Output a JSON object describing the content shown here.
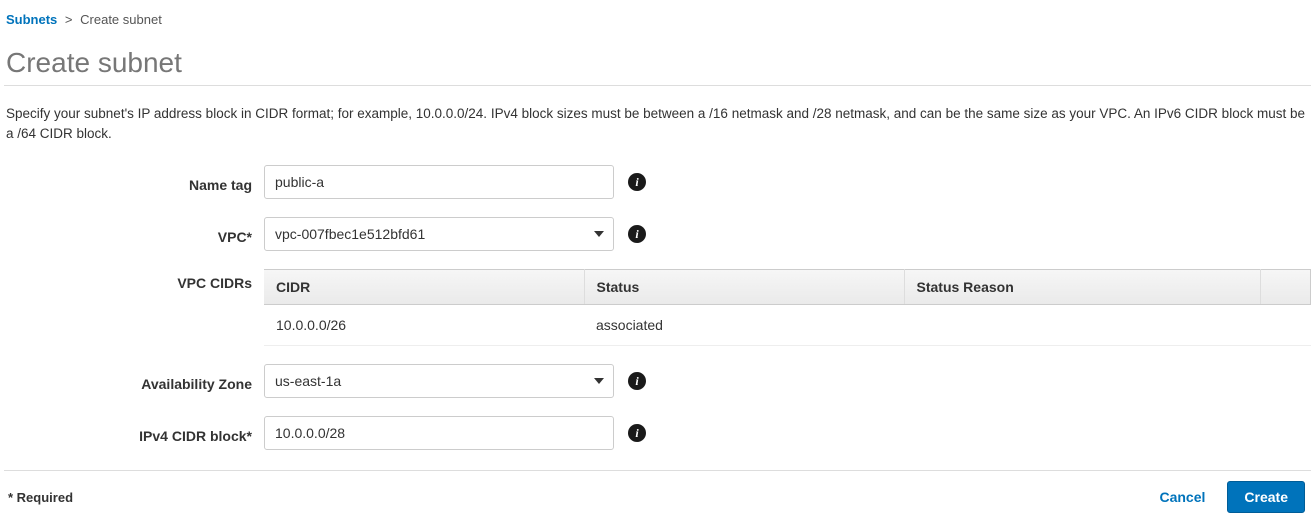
{
  "breadcrumb": {
    "parent": "Subnets",
    "separator": ">",
    "current": "Create subnet"
  },
  "page_title": "Create subnet",
  "description": "Specify your subnet's IP address block in CIDR format; for example, 10.0.0.0/24. IPv4 block sizes must be between a /16 netmask and /28 netmask, and can be the same size as your VPC. An IPv6 CIDR block must be a /64 CIDR block.",
  "form": {
    "name_tag": {
      "label": "Name tag",
      "value": "public-a"
    },
    "vpc": {
      "label": "VPC*",
      "value": "vpc-007fbec1e512bfd61"
    },
    "vpc_cidrs": {
      "label": "VPC CIDRs",
      "columns": {
        "cidr": "CIDR",
        "status": "Status",
        "reason": "Status Reason"
      },
      "rows": [
        {
          "cidr": "10.0.0.0/26",
          "status": "associated",
          "reason": ""
        }
      ]
    },
    "az": {
      "label": "Availability Zone",
      "value": "us-east-1a"
    },
    "ipv4": {
      "label": "IPv4 CIDR block*",
      "value": "10.0.0.0/28"
    }
  },
  "footer": {
    "required": "* Required",
    "cancel": "Cancel",
    "create": "Create"
  },
  "info_glyph": "i"
}
